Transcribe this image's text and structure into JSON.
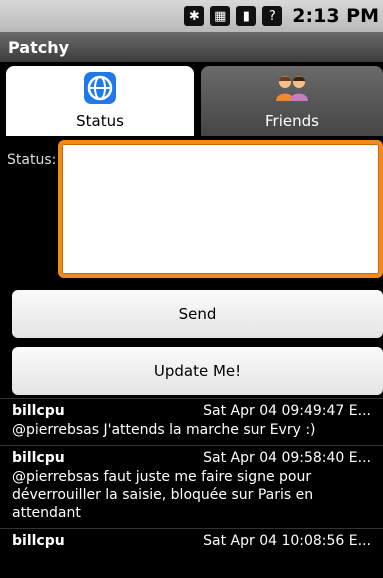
{
  "statusbar": {
    "time": "2:13 PM"
  },
  "app": {
    "title": "Patchy"
  },
  "tabs": [
    {
      "label": "Status",
      "icon": "globe-icon",
      "active": true
    },
    {
      "label": "Friends",
      "icon": "people-icon",
      "active": false
    }
  ],
  "form": {
    "status_label": "Status:",
    "status_value": "",
    "send_label": "Send",
    "update_label": "Update Me!"
  },
  "feed": [
    {
      "user": "billcpu",
      "time": "Sat Apr 04 09:49:47 E...",
      "text": "@pierrebsas J'attends la marche sur Evry :)"
    },
    {
      "user": "billcpu",
      "time": "Sat Apr 04 09:58:40 E...",
      "text": "@pierrebsas faut juste me faire signe pour déverrouiller la saisie, bloquée sur Paris en attendant"
    },
    {
      "user": "billcpu",
      "time": "Sat Apr 04 10:08:56 E...",
      "text": ""
    }
  ]
}
